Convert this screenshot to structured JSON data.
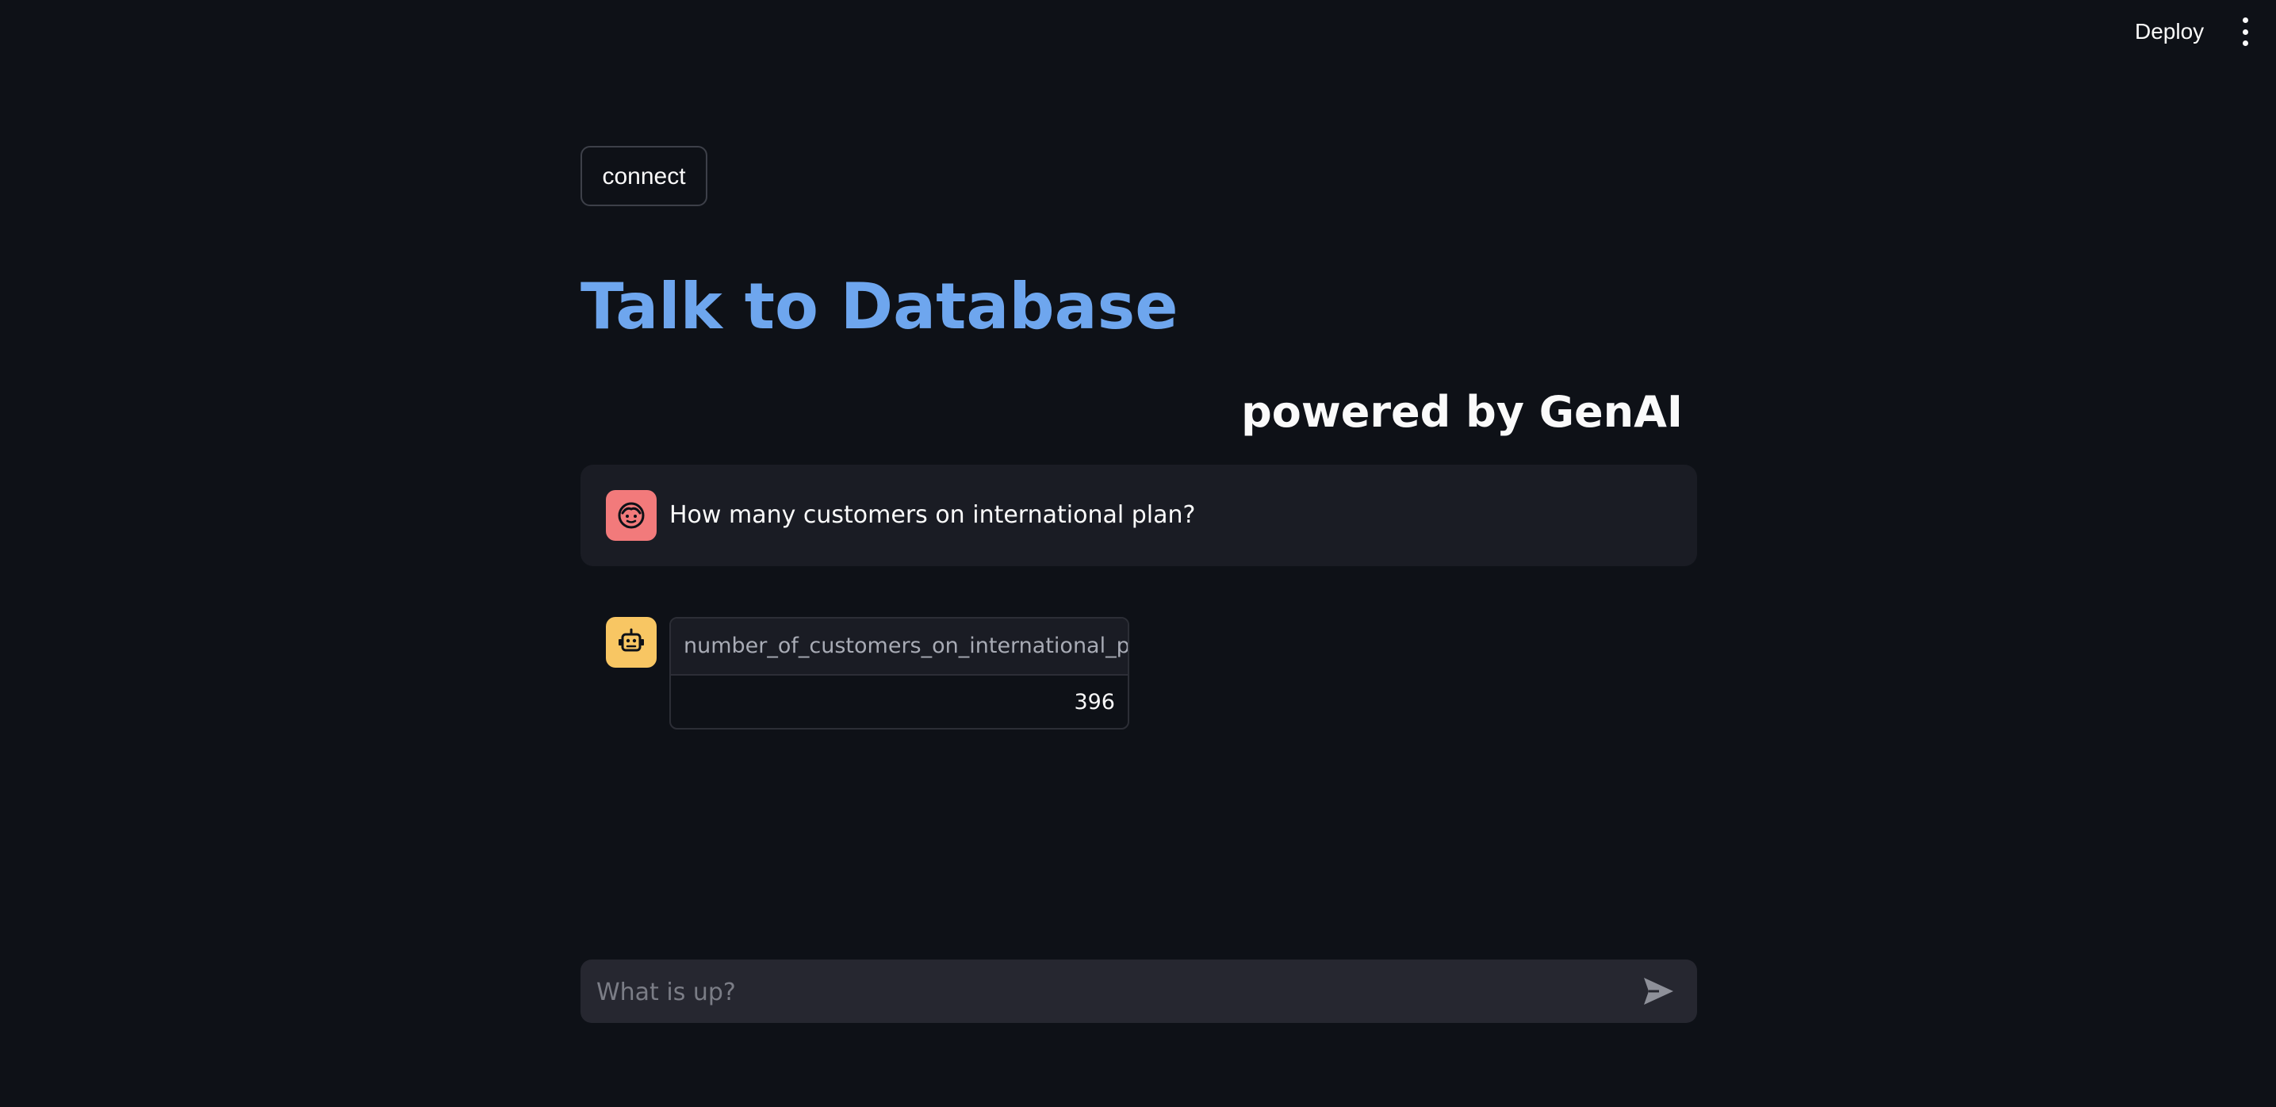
{
  "header": {
    "deploy_label": "Deploy",
    "menu_icon": "kebab-menu-icon"
  },
  "main": {
    "connect_label": "connect",
    "title": "Talk to Database",
    "subtitle": "powered by GenAI"
  },
  "chat": {
    "messages": [
      {
        "role": "user",
        "avatar_icon": "user-face-icon",
        "avatar_color": "#f27a7b",
        "text": "How many customers on international plan?"
      },
      {
        "role": "assistant",
        "avatar_icon": "robot-icon",
        "avatar_color": "#f8c663",
        "table": {
          "columns": [
            "number_of_customers_on_international_plan"
          ],
          "rows": [
            [
              "396"
            ]
          ]
        }
      }
    ]
  },
  "input": {
    "placeholder": "What is up?",
    "value": "",
    "send_icon": "send-icon"
  },
  "colors": {
    "background": "#0e1117",
    "title_accent": "#6ea6ee",
    "message_background": "#1a1c24",
    "input_background": "#262730"
  }
}
